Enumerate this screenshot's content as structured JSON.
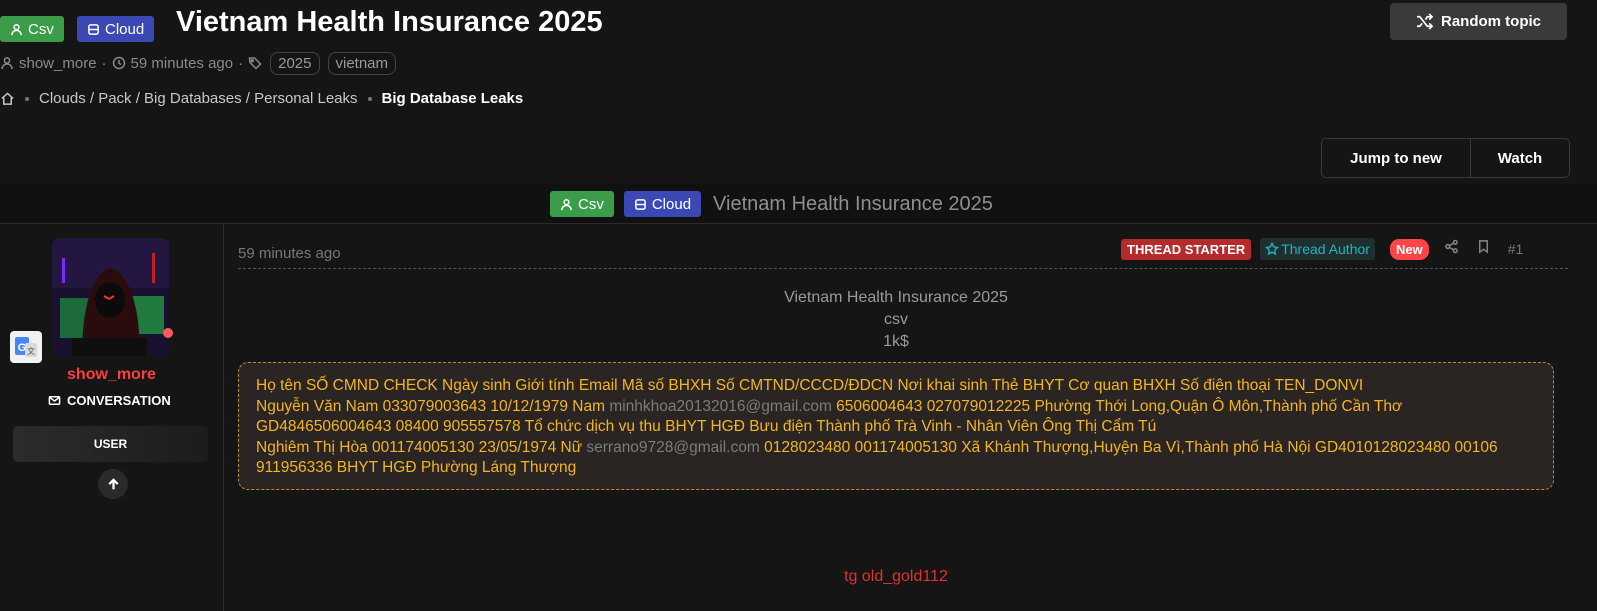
{
  "header": {
    "prefix_csv": "Csv",
    "prefix_cloud": "Cloud",
    "title": "Vietnam Health Insurance 2025",
    "author": "show_more",
    "time": "59 minutes ago",
    "tags": [
      "2025",
      "vietnam"
    ],
    "random_topic_label": "Random topic"
  },
  "breadcrumb": {
    "path": "Clouds / Pack / Big Databases / Personal Leaks",
    "current": "Big Database Leaks"
  },
  "actions": {
    "jump_label": "Jump to new",
    "watch_label": "Watch"
  },
  "thread_band": {
    "prefix_csv": "Csv",
    "prefix_cloud": "Cloud",
    "title": "Vietnam Health Insurance 2025"
  },
  "sidebar": {
    "username": "show_more",
    "conversation_label": "CONVERSATION",
    "role": "USER",
    "username_color": "#ff3d3d"
  },
  "post": {
    "time": "59 minutes ago",
    "badge_starter": "THREAD STARTER",
    "badge_author": "Thread Author",
    "badge_new": "New",
    "number": "#1",
    "intro_title": "Vietnam Health Insurance 2025",
    "intro_format": "csv",
    "intro_size": "1k$",
    "leak_lines": [
      {
        "a": "Họ tên SỐ CMND CHECK Ngày sinh Giới tính Email Mã số BHXH Số CMTND/CCCD/ĐDCN Nơi khai sinh Thẻ BHYT Cơ quan BHXH Số điện thoại TEN_DONVI",
        "email": "",
        "b": ""
      },
      {
        "a": "Nguyễn Văn Nam 033079003643 10/12/1979 Nam ",
        "email": "minhkhoa20132016@gmail.com",
        "b": " 6506004643 027079012225 Phường Thới Long,Quận Ô Môn,Thành phố Cần Thơ"
      },
      {
        "a": "GD4846506004643 08400 905557578 Tổ chức dịch vụ thu BHYT HGĐ Bưu điện Thành phố Trà Vinh - Nhân Viên Ông Thị Cẩm Tú",
        "email": "",
        "b": ""
      },
      {
        "a": "Nghiêm Thị Hòa 001174005130 23/05/1974 Nữ ",
        "email": "serrano9728@gmail.com",
        "b": " 0128023480 001174005130 Xã Khánh Thượng,Huyện Ba Vì,Thành phố Hà Nội GD4010128023480 00106"
      },
      {
        "a": "911956336 BHYT HGĐ Phường Láng Thượng",
        "email": "",
        "b": ""
      }
    ],
    "signature": "tg old_gold112"
  },
  "colors": {
    "background": "#151515",
    "prefix_csv": "#3b9d4a",
    "prefix_cloud": "#3c48b4",
    "leak_text": "#f3b524",
    "leak_border": "#c48a14",
    "signature": "#e23030"
  }
}
